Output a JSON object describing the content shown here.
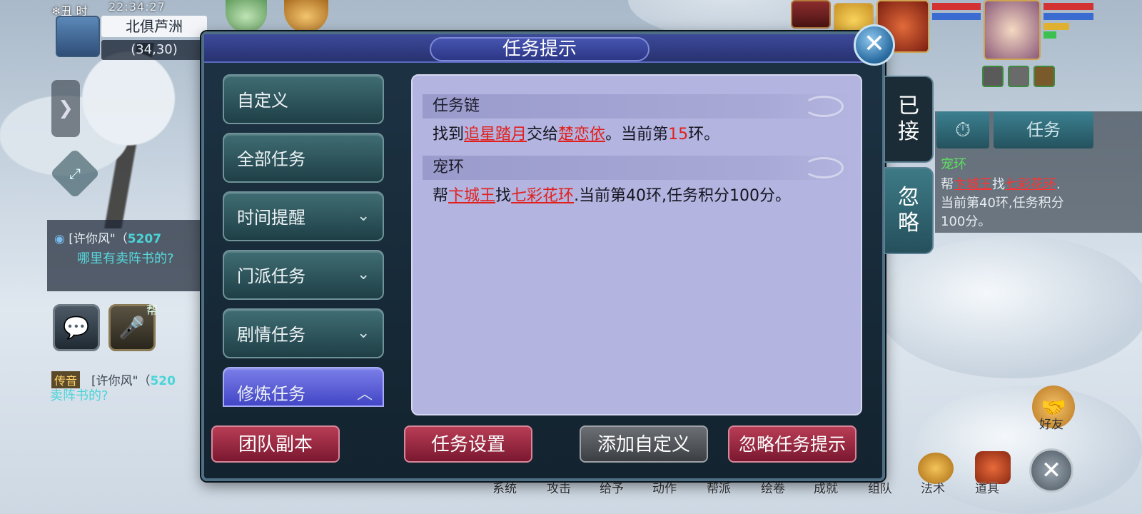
{
  "hud": {
    "time_label": "❄丑 时",
    "clock": "22:34:27",
    "map_name": "北俱芦洲",
    "coords": "(34,30)"
  },
  "chat": {
    "msg1_name": "[许你风\"（",
    "msg1_num": "5207",
    "msg1_text": "哪里有卖阵书的?",
    "msg2_tag": "传音",
    "msg2_name": "[许你风\"（",
    "msg2_num": "520",
    "msg2_text": "卖阵书的?",
    "voice_badge": "帮"
  },
  "tracker": {
    "tab_task": "任务",
    "title": "宠环",
    "line1_pre": "帮",
    "line1_npc": "卞城王",
    "line1_mid": "找",
    "line1_item": "七彩花环",
    "line1_end": ".",
    "line2": "当前第40环,任务积分",
    "line3": "100分。"
  },
  "dialog": {
    "title": "任务提示",
    "categories": [
      {
        "label": "自定义",
        "has_chevron": false
      },
      {
        "label": "全部任务",
        "has_chevron": false
      },
      {
        "label": "时间提醒",
        "has_chevron": true
      },
      {
        "label": "门派任务",
        "has_chevron": true
      },
      {
        "label": "剧情任务",
        "has_chevron": true
      },
      {
        "label": "修炼任务",
        "has_chevron": true
      }
    ],
    "sections": [
      {
        "heading": "任务链",
        "pre": "找到",
        "item": "追星踏月",
        "mid": "交给",
        "npc": "楚恋依",
        "after": "。当前第",
        "round": "15",
        "end": "环。"
      },
      {
        "heading": "宠环",
        "pre": "帮",
        "npc": "卞城王",
        "mid": "找",
        "item": "七彩花环",
        "after": ".当前第40环,任务积分100分。"
      }
    ],
    "side_tabs": {
      "accepted": [
        "已",
        "接"
      ],
      "ignored": [
        "忽",
        "略"
      ]
    },
    "buttons": {
      "team_dungeon": "团队副本",
      "task_settings": "任务设置",
      "add_custom": "添加自定义",
      "ignore_tips": "忽略任务提示"
    }
  },
  "bottombar": {
    "items": [
      "系统",
      "攻击",
      "给予",
      "动作",
      "帮派",
      "绘卷",
      "成就",
      "组队",
      "法术",
      "道具"
    ],
    "friends": "好友"
  },
  "colors": {
    "highlight_red": "#e0201e",
    "content_bg": "#b3b4df",
    "active_category": "#5a5ed8",
    "red_button": "#9a2840",
    "gray_button": "#55585c"
  }
}
